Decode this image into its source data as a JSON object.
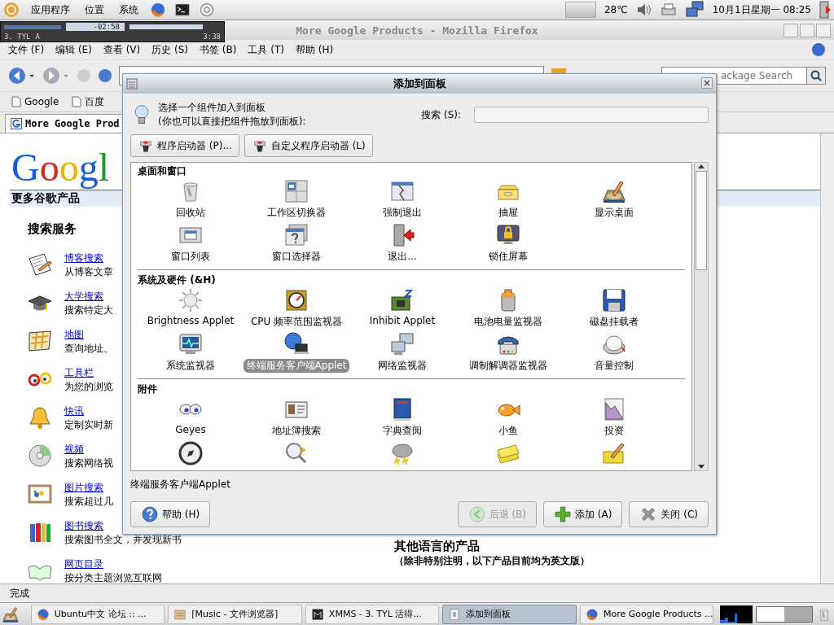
{
  "top_panel": {
    "menus": [
      "应用程序",
      "位置",
      "系统"
    ],
    "temperature": "28℃",
    "clock": "10月1日星期一 08:25"
  },
  "xmms": {
    "time": "-02:58",
    "track": "3. TYL",
    "channel": "A",
    "duration": "3:38"
  },
  "browser": {
    "title": "More Google Products - Mozilla Firefox",
    "menu": [
      "文件 (F)",
      "编辑 (E)",
      "查看 (V)",
      "历史 (S)",
      "书签 (B)",
      "工具 (T)",
      "帮助 (H)"
    ],
    "search_placeholder": "ackage Search",
    "bookmarks": [
      "Google",
      "百度"
    ],
    "tab": "More Google Prod",
    "page": {
      "logo": "Googl",
      "heading": "更多谷歌产品",
      "section": "搜索服务",
      "services": [
        {
          "name": "博客搜索",
          "description": "从博客文章"
        },
        {
          "name": "大学搜索",
          "description": "搜索特定大"
        },
        {
          "name": "地图",
          "description": "查询地址、"
        },
        {
          "name": "工具栏",
          "description": "为您的浏览"
        },
        {
          "name": "快讯",
          "description": "定制实时新"
        },
        {
          "name": "视频",
          "description": "搜索网络视"
        },
        {
          "name": "图片搜索",
          "description": "搜索超过几"
        },
        {
          "name": "图书搜索",
          "description": "搜索图书全文，并发现新书"
        },
        {
          "name": "网页目录",
          "description": "按分类主题浏览互联网"
        }
      ],
      "other_heading": "其他语言的产品",
      "other_note": "（除非特别注明，以下产品目前均为英文版）"
    },
    "status": "完成"
  },
  "dialog": {
    "title": "添加到面板",
    "intro": [
      "选择一个组件加入到面板",
      "(你也可以直接把组件拖放到面板):"
    ],
    "search_label": "搜索 (S):",
    "launcher_buttons": [
      "程序启动器 (P)...",
      "自定义程序启动器 (L)"
    ],
    "sections": [
      {
        "title": "桌面和窗口",
        "items": [
          {
            "label": "回收站",
            "selected": false
          },
          {
            "label": "工作区切换器",
            "selected": false
          },
          {
            "label": "强制退出",
            "selected": false
          },
          {
            "label": "抽屉",
            "selected": false
          },
          {
            "label": "显示桌面",
            "selected": false
          },
          {
            "label": "窗口列表",
            "selected": false
          },
          {
            "label": "窗口选择器",
            "selected": false
          },
          {
            "label": "退出...",
            "selected": false
          },
          {
            "label": "锁住屏幕",
            "selected": false
          }
        ]
      },
      {
        "title": "系统及硬件 (&H)",
        "items": [
          {
            "label": "Brightness Applet",
            "selected": false
          },
          {
            "label": "CPU 频率范围监视器",
            "selected": false
          },
          {
            "label": "Inhibit Applet",
            "selected": false
          },
          {
            "label": "电池电量监视器",
            "selected": false
          },
          {
            "label": "磁盘挂载者",
            "selected": false
          },
          {
            "label": "系统监视器",
            "selected": false
          },
          {
            "label": "终端服务客户端Applet",
            "selected": true
          },
          {
            "label": "网络监视器",
            "selected": false
          },
          {
            "label": "调制解调器监视器",
            "selected": false
          },
          {
            "label": "音量控制",
            "selected": false
          }
        ]
      },
      {
        "title": "附件",
        "items": [
          {
            "label": "Geyes",
            "selected": false
          },
          {
            "label": "地址簿搜索",
            "selected": false
          },
          {
            "label": "字典查阅",
            "selected": false
          },
          {
            "label": "小鱼",
            "selected": false
          },
          {
            "label": "投资",
            "selected": false
          },
          {
            "selected": false
          },
          {
            "selected": false
          },
          {
            "selected": false
          },
          {
            "selected": false
          },
          {
            "selected": false
          }
        ]
      }
    ],
    "selection_text": "终端服务客户端Applet",
    "help_button": "帮助 (H)",
    "action_buttons": [
      {
        "label": "后退 (B)",
        "disabled": true
      },
      {
        "label": "添加 (A)",
        "disabled": false
      },
      {
        "label": "关闭 (C)",
        "disabled": false
      }
    ]
  },
  "taskbar": {
    "tasks": [
      {
        "label": "Ubuntu中文 论坛 :: ...",
        "selected": false
      },
      {
        "label": "[Music - 文件浏览器]",
        "selected": false
      },
      {
        "label": "XMMS - 3. TYL 活得...",
        "selected": false
      },
      {
        "label": "添加到面板",
        "selected": true
      },
      {
        "label": "More Google Products ...",
        "selected": false
      }
    ]
  }
}
